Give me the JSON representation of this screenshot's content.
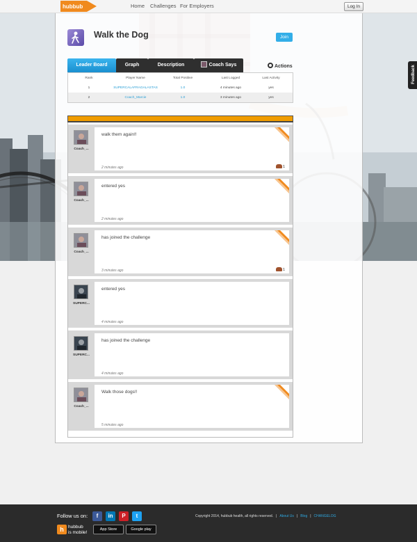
{
  "topbar": {
    "logo_text": "hubbub",
    "nav": [
      "Home",
      "Challenges",
      "For Employers"
    ],
    "login_label": "Log In"
  },
  "challenge": {
    "title": "Walk the Dog",
    "join_label": "Join"
  },
  "tabs": [
    "Leader Board",
    "Graph",
    "Description",
    "Coach Says"
  ],
  "actions_label": "Actions",
  "leaderboard": {
    "columns": [
      "Rank",
      "Player Name",
      "Total Positive",
      "Last Logged",
      "Last Activity"
    ],
    "rows": [
      {
        "rank": "1",
        "name": "SUPERCALAFRAGALASTAS",
        "total": "1.0",
        "logged": "4 minutes ago",
        "activity": "yes"
      },
      {
        "rank": "2",
        "name": "Coach_Marcie",
        "total": "1.0",
        "logged": "3 minutes ago",
        "activity": "yes"
      }
    ]
  },
  "feed": [
    {
      "author": "Coach_...",
      "text": "walk them again!!",
      "time": "2 minutes ago",
      "coach": true,
      "cheers": "1"
    },
    {
      "author": "Coach_...",
      "text": "entered yes",
      "time": "2 minutes ago",
      "coach": true,
      "cheers": ""
    },
    {
      "author": "Coach_...",
      "text": "has joined the challenge",
      "time": "3 minutes ago",
      "coach": true,
      "cheers": "1"
    },
    {
      "author": "SUPERC...",
      "text": "entered yes",
      "time": "4 minutes ago",
      "coach": false,
      "cheers": ""
    },
    {
      "author": "SUPERC...",
      "text": "has joined the challenge",
      "time": "4 minutes ago",
      "coach": false,
      "cheers": ""
    },
    {
      "author": "Coach_...",
      "text": "Walk those dogs!!",
      "time": "5 minutes ago",
      "coach": true,
      "cheers": ""
    }
  ],
  "feedback_label": "Feedback",
  "footer": {
    "follow_label": "Follow us on:",
    "social": [
      {
        "name": "facebook-icon",
        "glyph": "f",
        "color": "#3b5998"
      },
      {
        "name": "linkedin-icon",
        "glyph": "in",
        "color": "#0077b5"
      },
      {
        "name": "pinterest-icon",
        "glyph": "P",
        "color": "#cb2027"
      },
      {
        "name": "twitter-icon",
        "glyph": "t",
        "color": "#1da1f2"
      }
    ],
    "mobile_logo": "h",
    "mobile_line1": "hubbub",
    "mobile_line2": "is mobile!",
    "app_store": "App Store",
    "google_play": "Google play",
    "copyright": "Copyright 2014, hubbub health, all rights reserved.",
    "links": [
      "About Us",
      "Blog",
      "CHANGELOG"
    ]
  },
  "colors": {
    "accent_blue": "#2a9fd6",
    "ribbon_orange": "#f08a1e",
    "feed_header": "#f09c00",
    "tab_dark": "#2f2f2f"
  }
}
